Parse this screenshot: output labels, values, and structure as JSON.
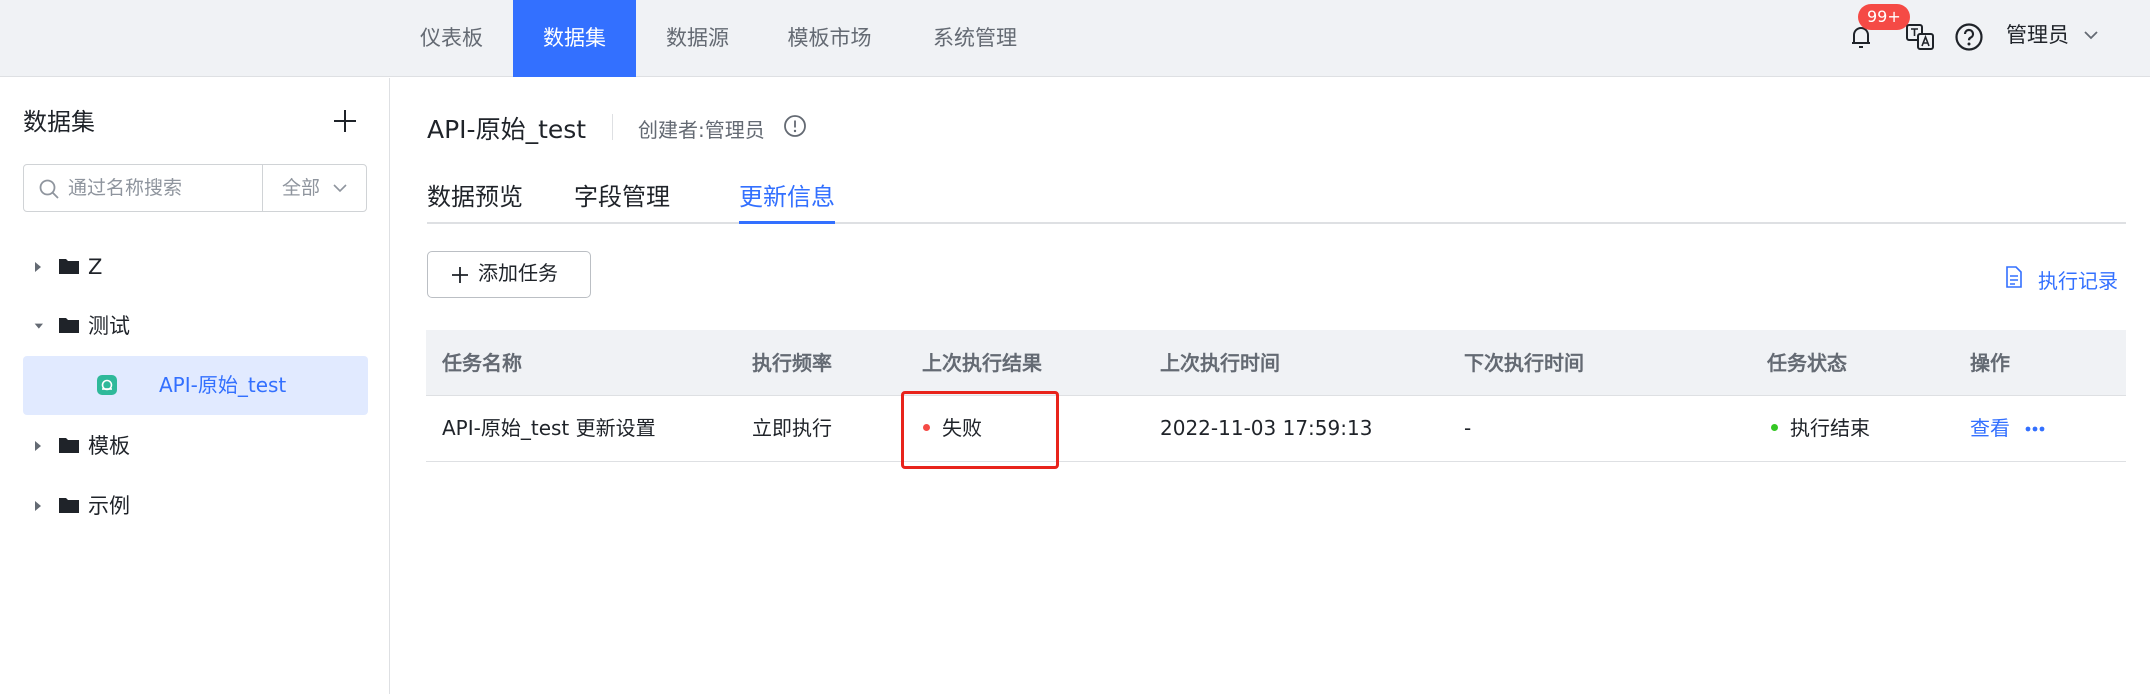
{
  "nav": {
    "items": [
      {
        "label": "仪表板"
      },
      {
        "label": "数据集"
      },
      {
        "label": "数据源"
      },
      {
        "label": "模板市场"
      },
      {
        "label": "系统管理"
      }
    ],
    "active_index": 1,
    "notification_badge": "99+",
    "user_name": "管理员",
    "icons": [
      "bell-icon",
      "translate-icon",
      "help-icon",
      "chevron-down-icon"
    ]
  },
  "sidebar": {
    "title": "数据集",
    "search": {
      "placeholder": "通过名称搜索",
      "value": "",
      "filter": "全部"
    },
    "tree": [
      {
        "label": "Z",
        "expanded": false
      },
      {
        "label": "测试",
        "expanded": true,
        "children": [
          {
            "label": "API-原始_test",
            "selected": true
          }
        ]
      },
      {
        "label": "模板",
        "expanded": false
      },
      {
        "label": "示例",
        "expanded": false
      }
    ]
  },
  "main": {
    "dataset_title": "API-原始_test",
    "creator": "创建者:管理员",
    "tabs": [
      {
        "label": "数据预览"
      },
      {
        "label": "字段管理"
      },
      {
        "label": "更新信息"
      }
    ],
    "active_tab": 2,
    "add_task_label": "添加任务",
    "exec_record_label": "执行记录",
    "table": {
      "columns": [
        "任务名称",
        "执行频率",
        "上次执行结果",
        "上次执行时间",
        "下次执行时间",
        "任务状态",
        "操作"
      ],
      "rows": [
        {
          "task_name": "API-原始_test 更新设置",
          "frequency": "立即执行",
          "last_result": "失败",
          "last_time": "2022-11-03 17:59:13",
          "next_time": "-",
          "status": "执行结束",
          "action": "查看"
        }
      ]
    },
    "colors": {
      "accent": "#3370ff",
      "fail_dot": "#f54a45",
      "success_dot": "#34c724",
      "highlight_box": "#e8231b"
    }
  }
}
